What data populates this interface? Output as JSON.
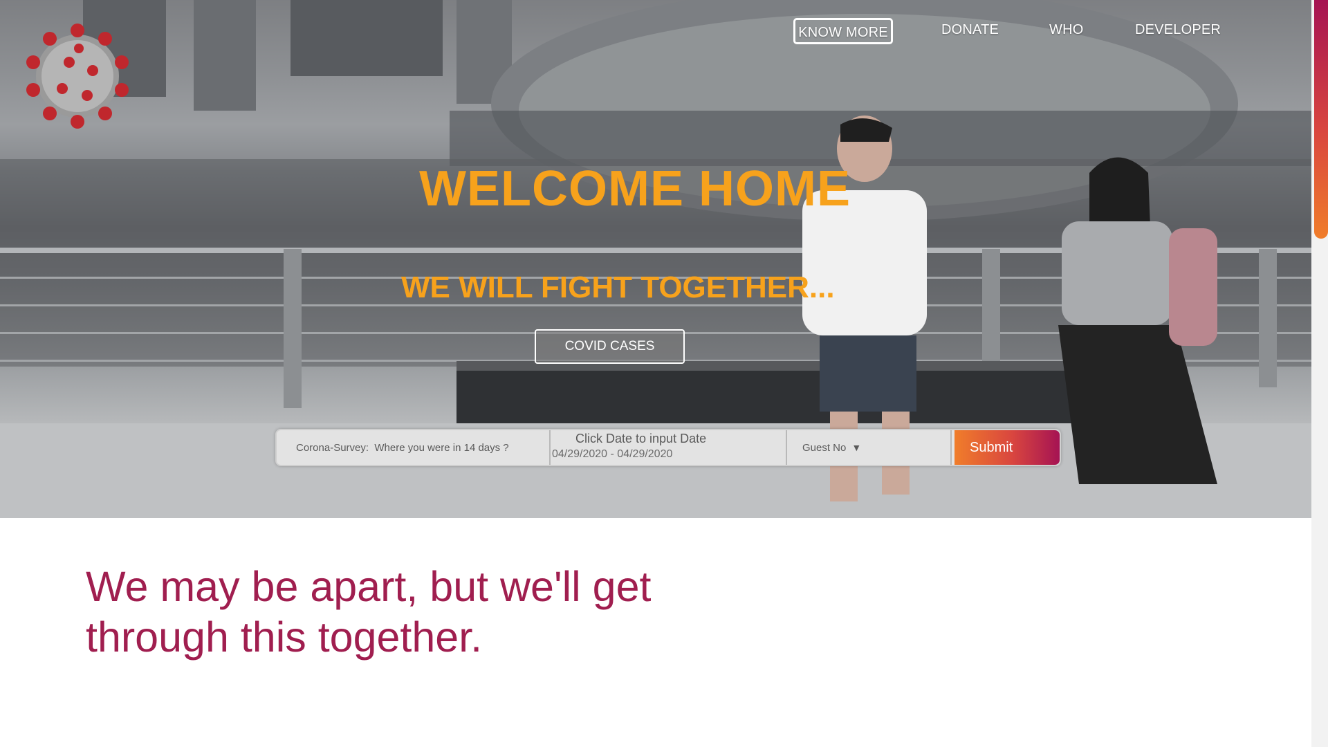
{
  "nav": {
    "know_more": "KNOW MORE",
    "donate": "DONATE",
    "who": "WHO",
    "developer": "DEVELOPER"
  },
  "hero": {
    "title": "WELCOME HOME",
    "subtitle": "WE WILL FIGHT TOGETHER...",
    "covid_button": "COVID CASES"
  },
  "survey": {
    "place_placeholder": "Corona-Survey:  Where you were in 14 days ?",
    "date_label": "Click Date to input Date",
    "date_value": "04/29/2020 - 04/29/2020",
    "guest_label": "Guest No",
    "submit_label": "Submit"
  },
  "tagline": "We may be apart, but we'll get through this together.",
  "colors": {
    "headline": "#f7a21c",
    "tagline": "#a01e4f",
    "gradient_start": "#f07d2a",
    "gradient_end": "#a51353"
  },
  "icons": {
    "logo": "coronavirus-logo-icon",
    "guest_caret": "caret-down-icon"
  }
}
